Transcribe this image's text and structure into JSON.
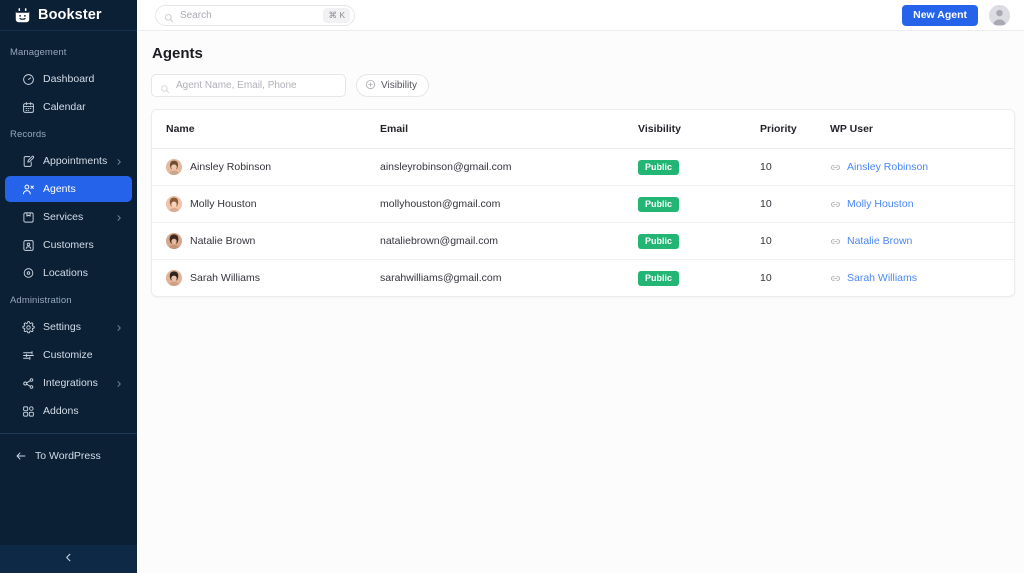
{
  "brand": {
    "name": "Bookster",
    "logo_icon": "calendar-smile-icon"
  },
  "sidebar": {
    "sections": [
      {
        "label": "Management",
        "items": [
          {
            "label": "Dashboard",
            "icon": "gauge-icon",
            "active": false,
            "chevron": false
          },
          {
            "label": "Calendar",
            "icon": "calendar-icon",
            "active": false,
            "chevron": false
          }
        ]
      },
      {
        "label": "Records",
        "items": [
          {
            "label": "Appointments",
            "icon": "edit-note-icon",
            "active": false,
            "chevron": true
          },
          {
            "label": "Agents",
            "icon": "user-group-icon",
            "active": true,
            "chevron": false
          },
          {
            "label": "Services",
            "icon": "package-icon",
            "active": false,
            "chevron": true
          },
          {
            "label": "Customers",
            "icon": "contact-card-icon",
            "active": false,
            "chevron": false
          },
          {
            "label": "Locations",
            "icon": "map-pin-icon",
            "active": false,
            "chevron": false
          }
        ]
      },
      {
        "label": "Administration",
        "items": [
          {
            "label": "Settings",
            "icon": "gear-icon",
            "active": false,
            "chevron": true
          },
          {
            "label": "Customize",
            "icon": "sliders-icon",
            "active": false,
            "chevron": false
          },
          {
            "label": "Integrations",
            "icon": "share-nodes-icon",
            "active": false,
            "chevron": true
          },
          {
            "label": "Addons",
            "icon": "blocks-icon",
            "active": false,
            "chevron": false
          }
        ]
      }
    ],
    "footer_link": {
      "label": "To WordPress",
      "icon": "arrow-left-icon"
    },
    "collapse": {
      "icon": "chevron-left-icon"
    },
    "accent_color": "#2563eb",
    "background_color": "#0b1f35"
  },
  "topbar": {
    "search": {
      "value": "",
      "placeholder": "Search",
      "icon": "search-icon",
      "shortcut": "⌘ K"
    },
    "new_agent_label": "New Agent",
    "avatar": "user-avatar"
  },
  "page": {
    "title": "Agents",
    "filters": {
      "search": {
        "value": "",
        "placeholder": "Agent Name, Email, Phone",
        "icon": "search-icon"
      },
      "visibility_button": {
        "label": "Visibility",
        "icon": "plus-circle-icon"
      }
    }
  },
  "table": {
    "columns": [
      "Name",
      "Email",
      "Visibility",
      "Priority",
      "WP User"
    ],
    "rows": [
      {
        "name": "Ainsley Robinson",
        "email": "ainsleyrobinson@gmail.com",
        "visibility": "Public",
        "priority": "10",
        "wp_user": "Ainsley Robinson",
        "avatar_colors": [
          "#6d4c38",
          "#e6b89c"
        ]
      },
      {
        "name": "Molly Houston",
        "email": "mollyhouston@gmail.com",
        "visibility": "Public",
        "priority": "10",
        "wp_user": "Molly Houston",
        "avatar_colors": [
          "#8a5a3b",
          "#f0c4a8"
        ]
      },
      {
        "name": "Natalie Brown",
        "email": "nataliebrown@gmail.com",
        "visibility": "Public",
        "priority": "10",
        "wp_user": "Natalie Brown",
        "avatar_colors": [
          "#3e2a20",
          "#d9a88c"
        ]
      },
      {
        "name": "Sarah Williams",
        "email": "sarahwilliams@gmail.com",
        "visibility": "Public",
        "priority": "10",
        "wp_user": "Sarah Williams",
        "avatar_colors": [
          "#2f2520",
          "#e2b497"
        ]
      }
    ],
    "badge_color": "#22b573",
    "link_color": "#4a86f7"
  }
}
